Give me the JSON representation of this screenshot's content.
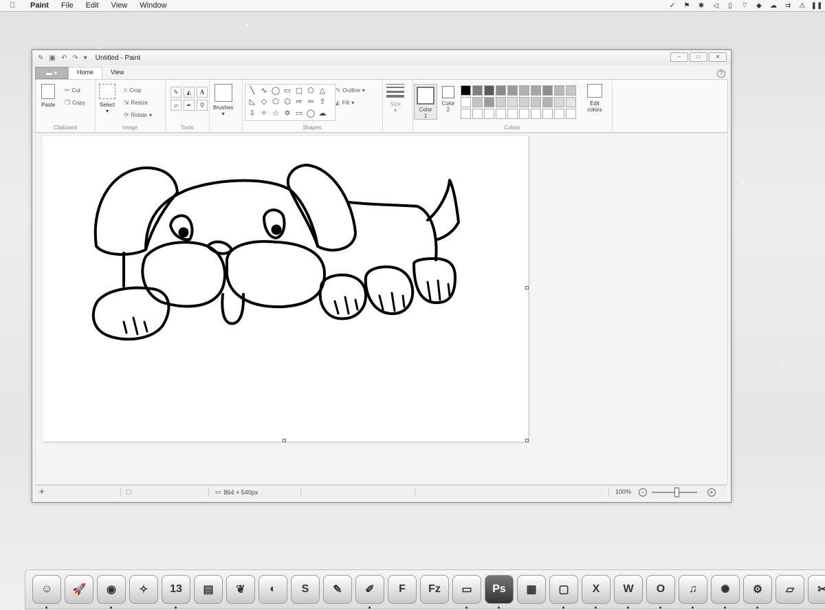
{
  "menubar": {
    "apple_icon": "apple-logo",
    "app_name": "Paint",
    "menus": [
      "File",
      "Edit",
      "View",
      "Window"
    ],
    "status_icons": [
      "check-icon",
      "flag-icon",
      "bluetooth-icon",
      "volume-icon",
      "battery-icon",
      "wifi-icon",
      "dropbox-icon",
      "cloud-icon",
      "arrows-icon",
      "alert-icon",
      "pause-icon"
    ]
  },
  "window": {
    "title": "Untitled - Paint",
    "tabs": {
      "file": "",
      "home": "Home",
      "view": "View"
    }
  },
  "ribbon": {
    "clipboard": {
      "paste": "Paste",
      "cut": "Cut",
      "copy": "Copy",
      "label": "Clipboard"
    },
    "image": {
      "select": "Select",
      "crop": "Crop",
      "resize": "Resize",
      "rotate": "Rotate",
      "label": "Image"
    },
    "tools": {
      "label": "Tools",
      "text_tool": "A"
    },
    "brushes": {
      "label": "Brushes"
    },
    "shapes": {
      "outline": "Outline",
      "fill": "Fill",
      "label": "Shapes"
    },
    "size": {
      "label": "Size"
    },
    "colors": {
      "color1": "Color",
      "color1_num": "1",
      "color2": "Color",
      "color2_num": "2",
      "edit_colors": "Edit",
      "edit_colors_2": "colors",
      "label": "Colors",
      "palette": [
        "#000000",
        "#7f7f7f",
        "#5a5a5a",
        "#8a8a8a",
        "#9a9a9a",
        "#b0b0b0",
        "#a5a5a5",
        "#8f8f8f",
        "#b8b8b8",
        "#c5c5c5",
        "#ffffff",
        "#c3c3c3",
        "#9b9b9b",
        "#cfcfcf",
        "#dcdcdc",
        "#d0d0d0",
        "#c8c8c8",
        "#b3b3b3",
        "#d8d8d8",
        "#e5e5e5",
        "#ffffff",
        "#ffffff",
        "#ffffff",
        "#ffffff",
        "#ffffff",
        "#ffffff",
        "#ffffff",
        "#ffffff",
        "#ffffff",
        "#ffffff"
      ]
    }
  },
  "statusbar": {
    "canvas_size": "864 × 540px",
    "zoom": "100%"
  },
  "dock": {
    "apps": [
      {
        "name": "finder-icon",
        "glyph": "☺"
      },
      {
        "name": "launchpad-icon",
        "glyph": "🚀"
      },
      {
        "name": "chrome-icon",
        "glyph": "◉"
      },
      {
        "name": "safari-icon",
        "glyph": "✧"
      },
      {
        "name": "calendar-icon",
        "glyph": "13"
      },
      {
        "name": "notes-icon",
        "glyph": "▤"
      },
      {
        "name": "evernote-icon",
        "glyph": "❦"
      },
      {
        "name": "messages-icon",
        "glyph": "◐"
      },
      {
        "name": "skype-icon",
        "glyph": "S"
      },
      {
        "name": "textedit-icon",
        "glyph": "✎"
      },
      {
        "name": "paint-icon",
        "glyph": "✐"
      },
      {
        "name": "font-icon",
        "glyph": "F"
      },
      {
        "name": "filezilla-icon",
        "glyph": "Fz"
      },
      {
        "name": "preview-icon",
        "glyph": "▭"
      },
      {
        "name": "photoshop-icon",
        "glyph": "Ps"
      },
      {
        "name": "preferences-icon",
        "glyph": "▦"
      },
      {
        "name": "screen-icon",
        "glyph": "▢"
      },
      {
        "name": "excel-icon",
        "glyph": "X"
      },
      {
        "name": "word-icon",
        "glyph": "W"
      },
      {
        "name": "outlook-icon",
        "glyph": "O"
      },
      {
        "name": "itunes-icon",
        "glyph": "♫"
      },
      {
        "name": "settings-gear-icon",
        "glyph": "✺"
      },
      {
        "name": "system-preferences-icon",
        "glyph": "⚙"
      },
      {
        "name": "folder-icon",
        "glyph": "▱"
      },
      {
        "name": "tools-icon",
        "glyph": "✂"
      }
    ]
  }
}
